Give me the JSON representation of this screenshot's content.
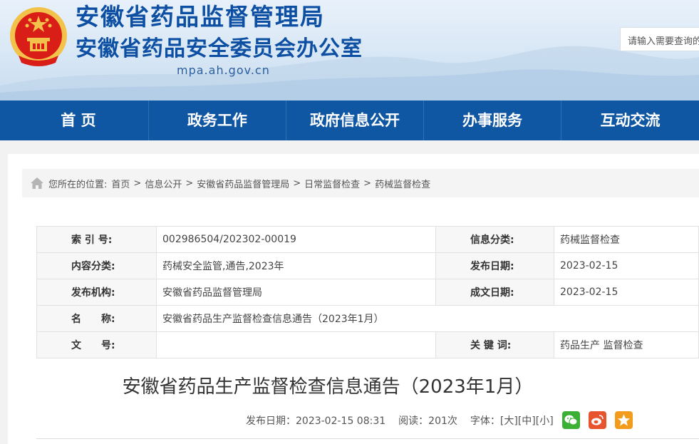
{
  "header": {
    "title_main": "安徽省药品监督管理局",
    "title_sub": "安徽省药品安全委员会办公室",
    "domain": "mpa.ah.gov.cn",
    "emblem_icon": "national-emblem-icon",
    "search_placeholder": "请输入需要查询的内容"
  },
  "nav": {
    "items": [
      "首 页",
      "政务工作",
      "政府信息公开",
      "办事服务",
      "互动交流"
    ]
  },
  "breadcrumb": {
    "icon": "home-icon",
    "prefix": "您所在的位置:",
    "items": [
      "首页",
      "信息公开",
      "安徽省药品监督管理局",
      "日常监督检查",
      "药械监督检查"
    ],
    "separator": ">"
  },
  "meta": {
    "index_label": "索 引 号:",
    "index_value": "002986504/202302-00019",
    "category_label": "信息分类:",
    "category_value": "药械监督检查",
    "content_label": "内容分类:",
    "content_value": "药械安全监管,通告,2023年",
    "pubdate_label": "发布日期:",
    "pubdate_value": "2023-02-15",
    "org_label": "发布机构:",
    "org_value": "安徽省药品监督管理局",
    "written_label": "成文日期:",
    "written_value": "2023-02-15",
    "name_label": "名　　称:",
    "name_value": "安徽省药品生产监督检查信息通告（2023年1月）",
    "doc_label": "文　　号:",
    "doc_value": "",
    "keyword_label": "关 键 词:",
    "keyword_value": "药品生产 监督检查"
  },
  "article": {
    "title": "安徽省药品生产监督检查信息通告（2023年1月）",
    "publish": "发布日期：2023-02-15 08:31",
    "reads": "阅读：201次",
    "font_label": "字体：",
    "font_large": "[大]",
    "font_medium": "[中]",
    "font_small": "[小]"
  },
  "share": {
    "wechat_icon": "wechat-icon",
    "weibo_icon": "weibo-icon",
    "favorite_icon": "star-icon",
    "colors": {
      "wechat": "#3cb034",
      "weibo": "#e8542e",
      "favorite": "#f39c1c"
    }
  },
  "colors": {
    "brand": "#0f56a3",
    "title": "#0d4fa3"
  }
}
